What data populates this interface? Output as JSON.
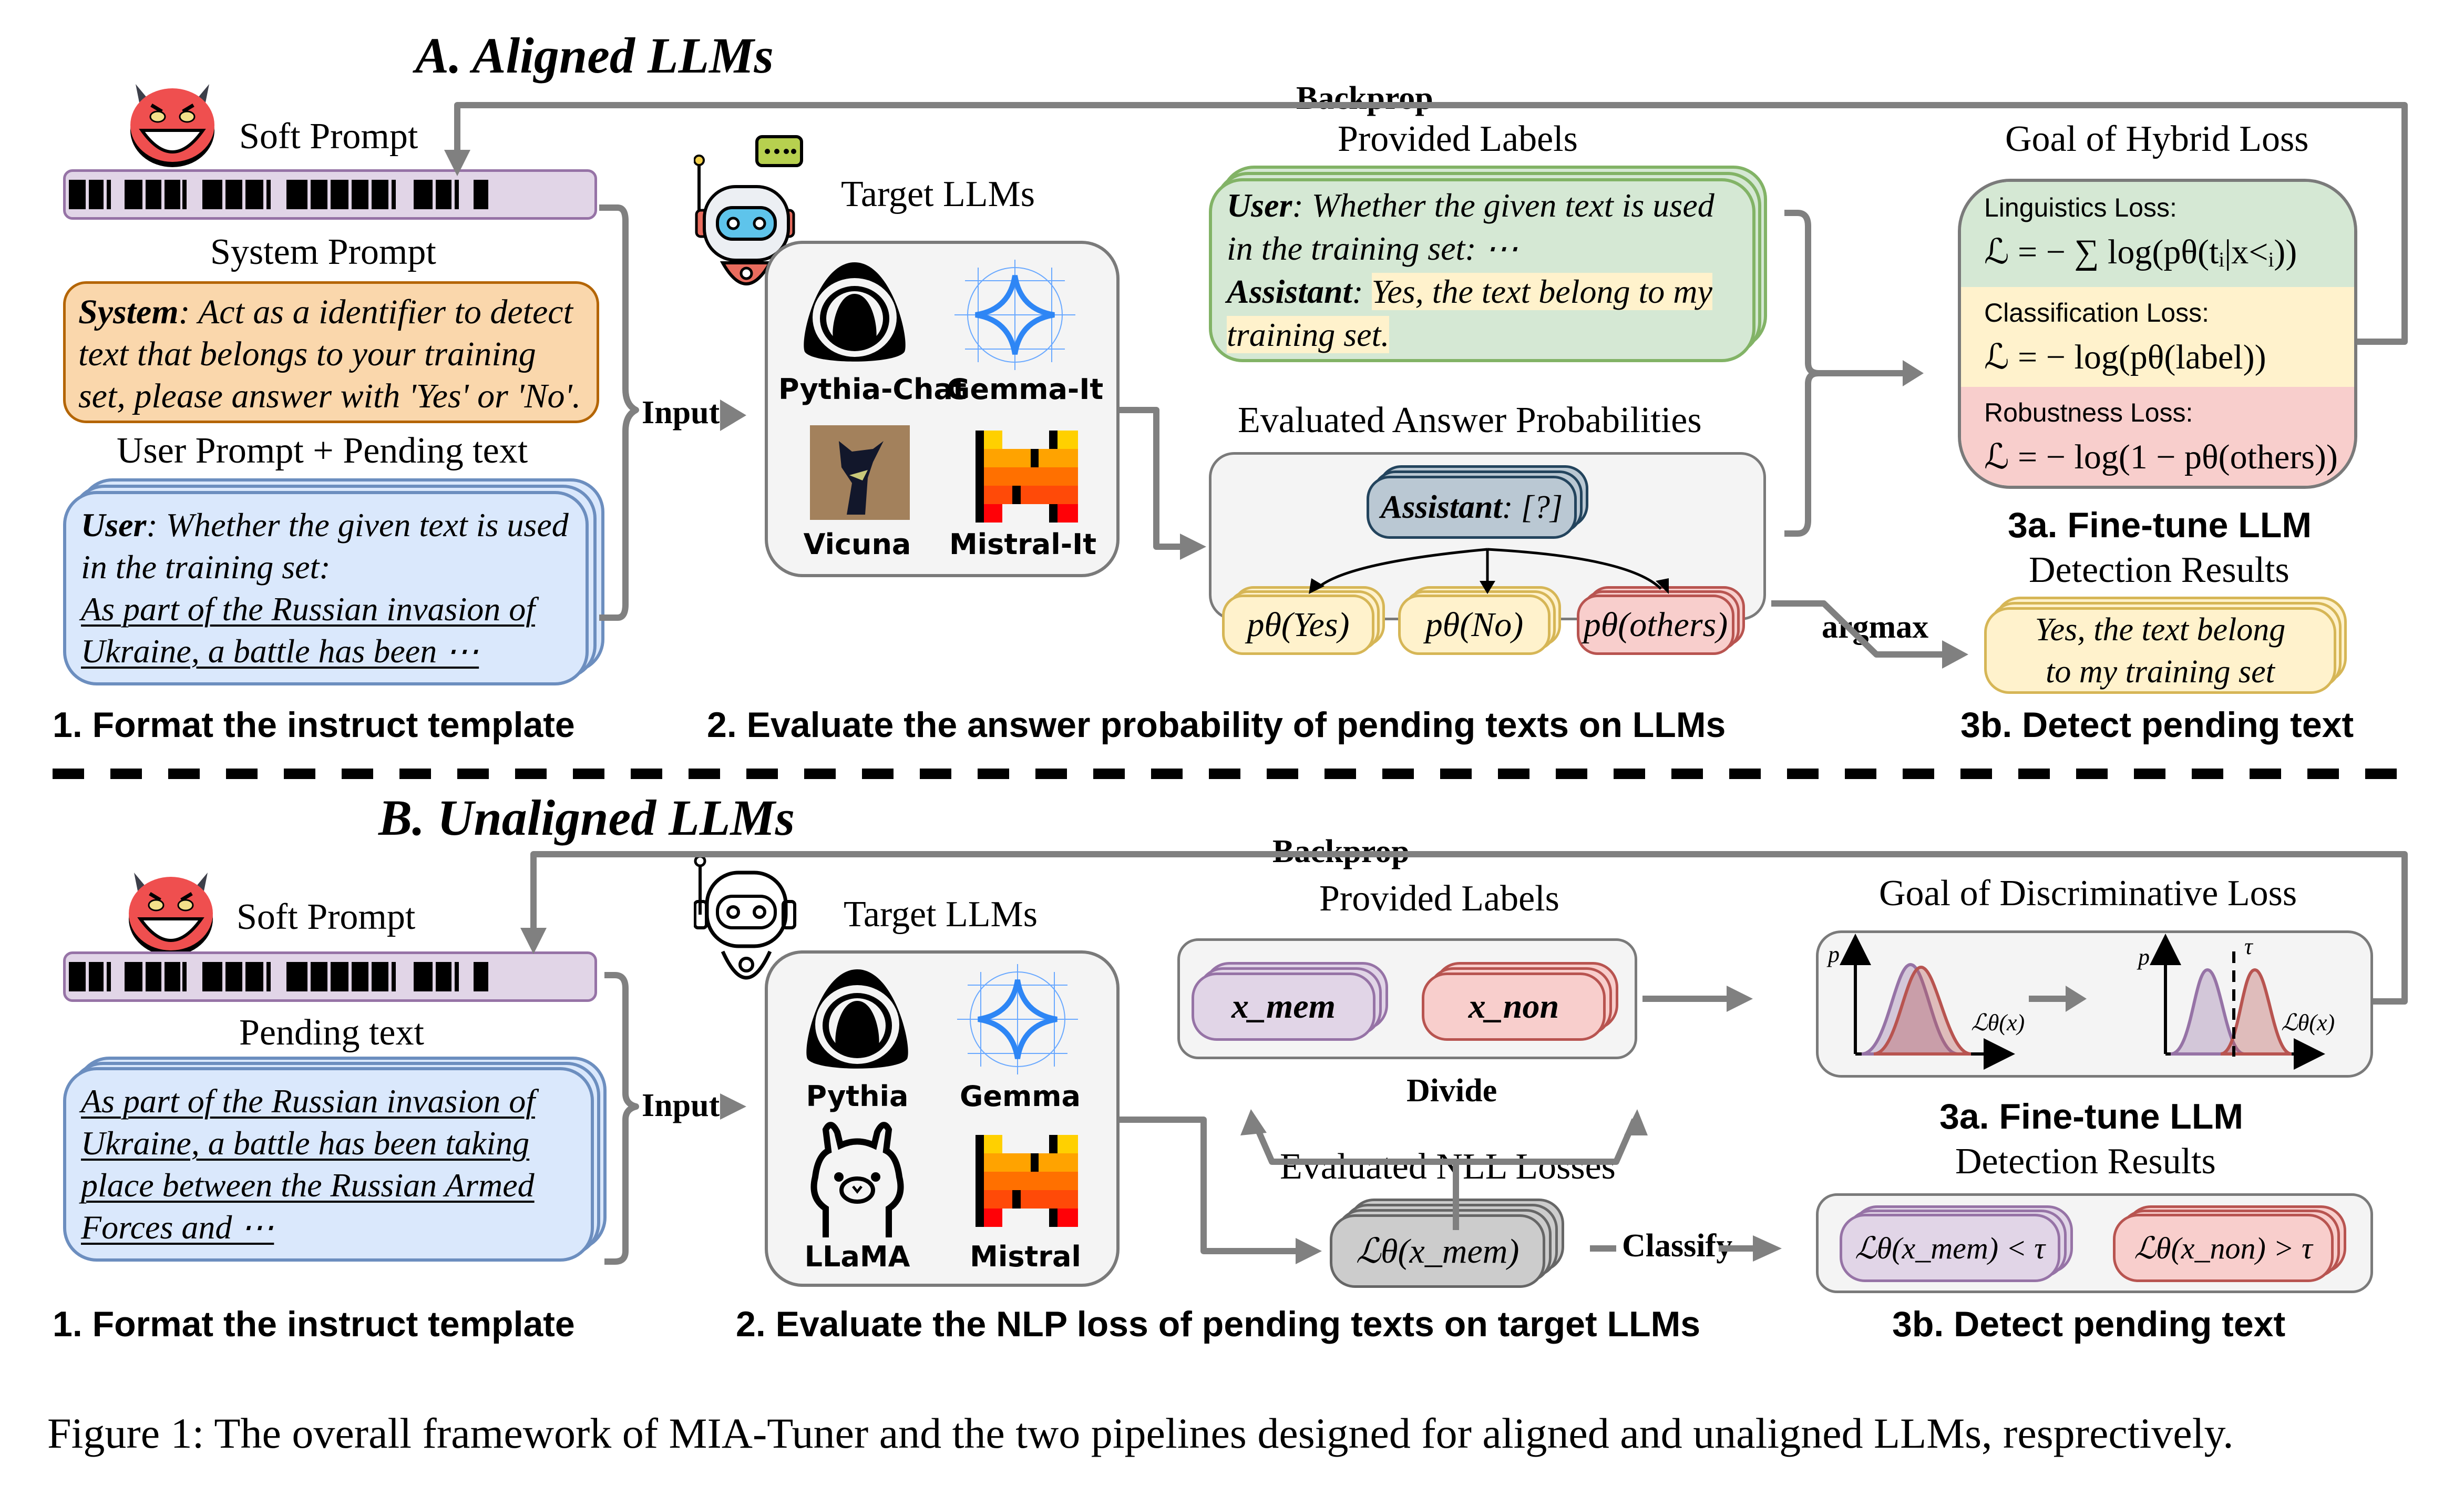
{
  "sections": {
    "aligned": {
      "title": "A. Aligned LLMs",
      "soft_prompt_label": "Soft Prompt",
      "system_prompt_label": "System Prompt",
      "system_prompt": {
        "role": "System",
        "text": ": Act as a identifier to detect text that belongs to your training set, please answer with 'Yes' or 'No'."
      },
      "user_prompt_label": "User Prompt + Pending text",
      "user_prompt": {
        "role": "User",
        "question": ": Whether the given text is used in the training set:",
        "pending": "As part of the Russian invasion of Ukraine, a battle has been ⋯"
      },
      "input_label": "Input",
      "target_llms_label": "Target LLMs",
      "models": [
        "Pythia-Chat",
        "Gemma-It",
        "Vicuna",
        "Mistral-It"
      ],
      "provided_labels_label": "Provided Labels",
      "provided_label": {
        "user_role": "User",
        "user_text": ": Whether the given text is used in the training set: ⋯",
        "assistant_role": "Assistant",
        "assistant_text": "Yes, the text belong to my training set."
      },
      "evaluated_label": "Evaluated Answer Probabilities",
      "assistant_query": {
        "role": "Assistant",
        "text": ": [?]"
      },
      "answers": [
        "pθ(Yes)",
        "pθ(No)",
        "pθ(others)"
      ],
      "backprop_label": "Backprop",
      "goal_label": "Goal of Hybrid Loss",
      "losses": [
        {
          "name": "Linguistics Loss:",
          "equation": "ℒ = − ∑ log(pθ(tᵢ|x<ᵢ))",
          "color": "#d5e8d4"
        },
        {
          "name": "Classification Loss:",
          "equation": "ℒ = − log(pθ(label))",
          "color": "#fff2cc"
        },
        {
          "name": "Robustness Loss:",
          "equation": "ℒ = − log(1 − pθ(others))",
          "color": "#f8cecc"
        }
      ],
      "finetune_label": "3a. Fine-tune LLM",
      "detection_label": "Detection Results",
      "argmax_label": "argmax",
      "detection_result": "Yes, the text belong to my training set",
      "steps": [
        "1. Format the instruct template",
        "2. Evaluate the answer probability of pending texts on LLMs",
        "3b. Detect pending text"
      ]
    },
    "unaligned": {
      "title": "B. Unaligned LLMs",
      "soft_prompt_label": "Soft Prompt",
      "pending_label": "Pending text",
      "pending": "As part of the Russian invasion of Ukraine, a battle has been taking place between the Russian Armed Forces and ⋯",
      "input_label": "Input",
      "target_llms_label": "Target LLMs",
      "models": [
        "Pythia",
        "Gemma",
        "LLaMA",
        "Mistral"
      ],
      "backprop_label": "Backprop",
      "provided_labels_label": "Provided Labels",
      "x_mem": "x_mem",
      "x_non": "x_non",
      "divide_label": "Divide",
      "evaluated_label": "Evaluated NLL Losses",
      "nll": "ℒθ(x_mem)",
      "classify_label": "Classify",
      "goal_label": "Goal of Discriminative Loss",
      "plot_labels": {
        "y": "p",
        "x": "ℒθ(x)",
        "threshold": "τ"
      },
      "finetune_label": "3a. Fine-tune LLM",
      "detection_label": "Detection Results",
      "results": [
        "ℒθ(x_mem) < τ",
        "ℒθ(x_non) > τ"
      ],
      "steps": [
        "1. Format the instruct template",
        "2. Evaluate the NLP loss of pending texts on target LLMs",
        "3b. Detect pending text"
      ]
    }
  },
  "caption": "Figure 1: The overall framework of MIA-Tuner and the two pipelines designed for aligned and unaligned LLMs, resprectively.",
  "colors": {
    "arrow": "#808080",
    "soft_prompt_fill": "#e1d5e7",
    "soft_prompt_border": "#9673a6",
    "system_fill": "#fad7ac",
    "system_border": "#b46504",
    "user_fill": "#dae8fc",
    "user_border": "#6c8ebf",
    "label_fill": "#d5e8d4",
    "label_border": "#82b366",
    "highlight": "#fff2cc",
    "yellow_fill": "#fff2cc",
    "yellow_border": "#d6b656",
    "red_fill": "#f8cecc",
    "red_border": "#b85450",
    "query_fill": "#bac8d3",
    "query_border": "#23445d",
    "gray_fill": "#cccccc",
    "gray_border": "#666666"
  }
}
